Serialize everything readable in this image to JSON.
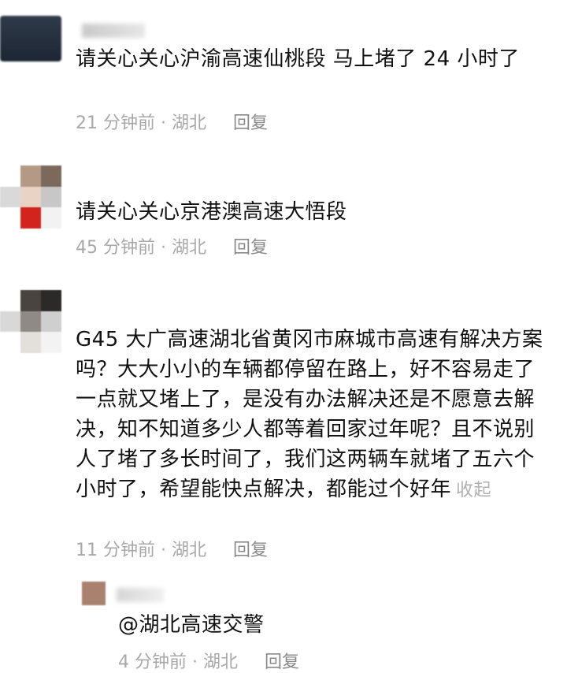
{
  "comments": [
    {
      "text": "请关心关心沪渝高速仙桃段 马上堵了 24 小时了",
      "time": "21 分钟前 · 湖北",
      "reply_label": "回复"
    },
    {
      "text": "请关心关心京港澳高速大悟段",
      "time": "45 分钟前 · 湖北",
      "reply_label": "回复"
    },
    {
      "text": "G45 大广高速湖北省黄冈市麻城市高速有解决方案吗？大大小小的车辆都停留在路上，好不容易走了一点就又堵上了，是没有办法解决还是不愿意去解决，知不知道多少人都等着回家过年呢？且不说别人了堵了多长时间了，我们这两辆车就堵了五六个小时了，希望能快点解决，都能过个好年",
      "collapse_label": "收起",
      "time": "11 分钟前 · 湖北",
      "reply_label": "回复"
    },
    {
      "text": "@湖北高速交警",
      "time": "4 分钟前 · 湖北",
      "reply_label": "回复"
    }
  ],
  "colors": {
    "text": "#111111",
    "meta": "#a8a8a8",
    "collapse": "#b0b0b0"
  }
}
